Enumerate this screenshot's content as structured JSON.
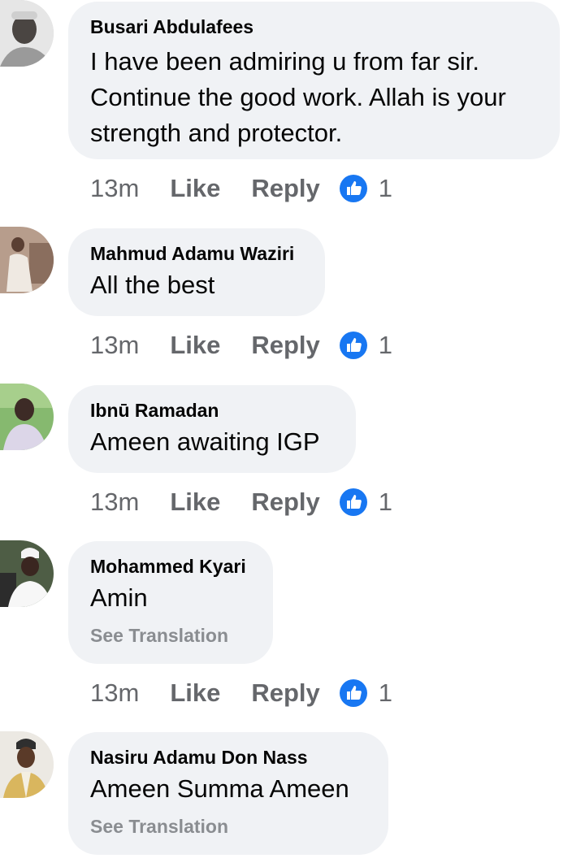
{
  "comments": [
    {
      "author": "Busari Abdulafees",
      "text_lines": [
        "I have been admiring u from far sir.",
        "Continue the good work. Allah is your",
        "strength and protector."
      ],
      "see_translation": "",
      "time": "13m",
      "like_label": "Like",
      "reply_label": "Reply",
      "reaction_icon": "like-icon",
      "reaction_count": "1",
      "colors": {
        "avatar_bg": "#dcdcdc",
        "avatar_fg": "#3a3a3a"
      }
    },
    {
      "author": "Mahmud Adamu Waziri",
      "text_lines": [
        "All the best"
      ],
      "see_translation": "",
      "time": "13m",
      "like_label": "Like",
      "reply_label": "Reply",
      "reaction_icon": "like-icon",
      "reaction_count": "1",
      "colors": {
        "avatar_bg": "#bfa89a",
        "avatar_fg": "#e8e0d8"
      }
    },
    {
      "author": "Ibnū Ramadan",
      "text_lines": [
        "Ameen awaiting IGP"
      ],
      "see_translation": "",
      "time": "13m",
      "like_label": "Like",
      "reply_label": "Reply",
      "reaction_icon": "like-icon",
      "reaction_count": "1",
      "colors": {
        "avatar_bg": "#7fb36b",
        "avatar_fg": "#3b2a2a"
      }
    },
    {
      "author": "Mohammed Kyari",
      "text_lines": [
        "Amin"
      ],
      "see_translation": "See Translation",
      "time": "13m",
      "like_label": "Like",
      "reply_label": "Reply",
      "reaction_icon": "like-icon",
      "reaction_count": "1",
      "colors": {
        "avatar_bg": "#5a6b4f",
        "avatar_fg": "#f4f4f4"
      }
    },
    {
      "author": "Nasiru Adamu Don Nass",
      "text_lines": [
        "Ameen Summa Ameen"
      ],
      "see_translation": "See Translation",
      "time": "",
      "like_label": "",
      "reply_label": "",
      "reaction_icon": "",
      "reaction_count": "",
      "colors": {
        "avatar_bg": "#e9e6e0",
        "avatar_fg": "#d8b86a"
      }
    }
  ],
  "colors": {
    "bubble": "#f0f2f5",
    "name": "#050505",
    "meta": "#65676b",
    "translation": "#8a8d91",
    "like_blue": "#1877f2"
  }
}
